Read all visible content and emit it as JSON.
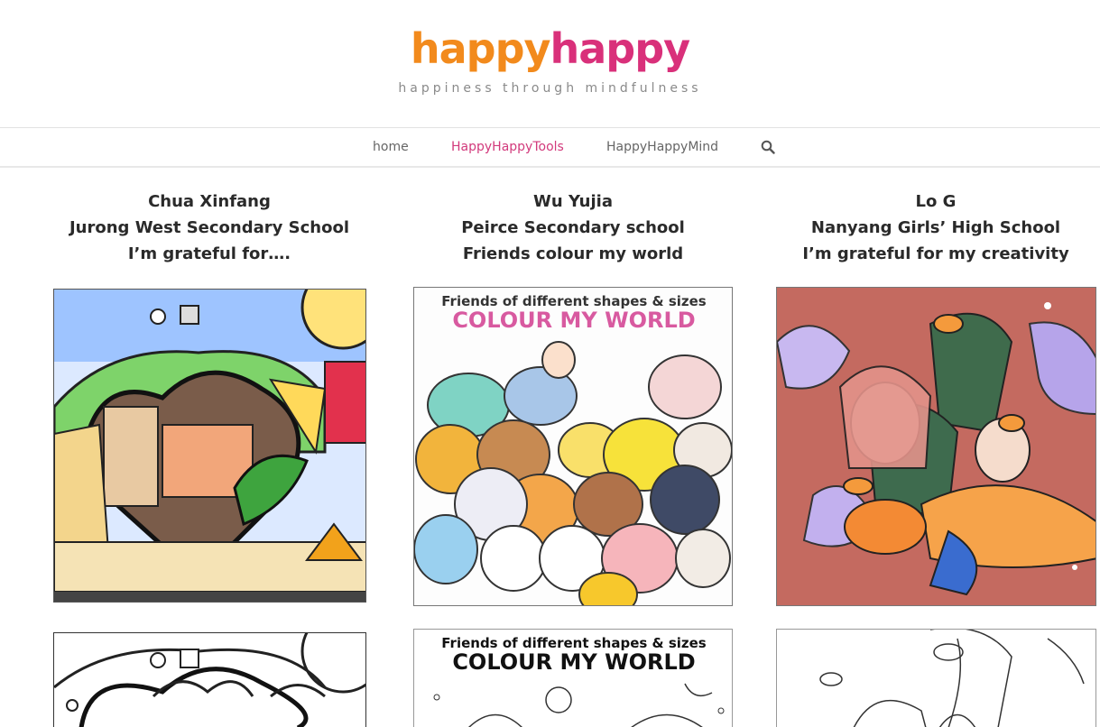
{
  "site": {
    "logo_part1": "happy",
    "logo_part2": "happy",
    "tagline": "happiness through mindfulness"
  },
  "nav": {
    "items": [
      {
        "label": "home",
        "active": false
      },
      {
        "label": "HappyHappyTools",
        "active": true
      },
      {
        "label": "HappyHappyMind",
        "active": false
      }
    ],
    "search_icon": "search-icon"
  },
  "entries": [
    {
      "name": "Chua Xinfang",
      "school": "Jurong West Secondary School",
      "caption": "I’m grateful for…."
    },
    {
      "name": "Wu Yujia",
      "school": "Peirce Secondary school",
      "caption": "Friends colour my world"
    },
    {
      "name": "Lo G",
      "school": "Nanyang Girls’ High School",
      "caption": "I’m grateful for my creativity"
    }
  ],
  "artwork": {
    "wu_header": "Friends of different shapes & sizes",
    "wu_title": "COLOUR MY WORLD"
  },
  "colors": {
    "brand_orange": "#f28a1c",
    "brand_pink": "#d9307a",
    "nav_active": "#d23a7c"
  }
}
